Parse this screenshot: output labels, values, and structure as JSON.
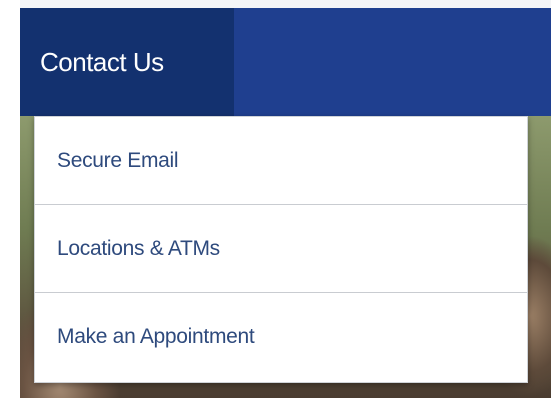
{
  "nav": {
    "active_label": "Contact Us"
  },
  "dropdown": {
    "items": [
      {
        "label": "Secure Email"
      },
      {
        "label": "Locations & ATMs"
      },
      {
        "label": "Make an Appointment"
      }
    ]
  },
  "colors": {
    "nav_bg": "#1f3f8f",
    "nav_active_bg": "#13316f",
    "dropdown_text": "#2e4a7d"
  }
}
